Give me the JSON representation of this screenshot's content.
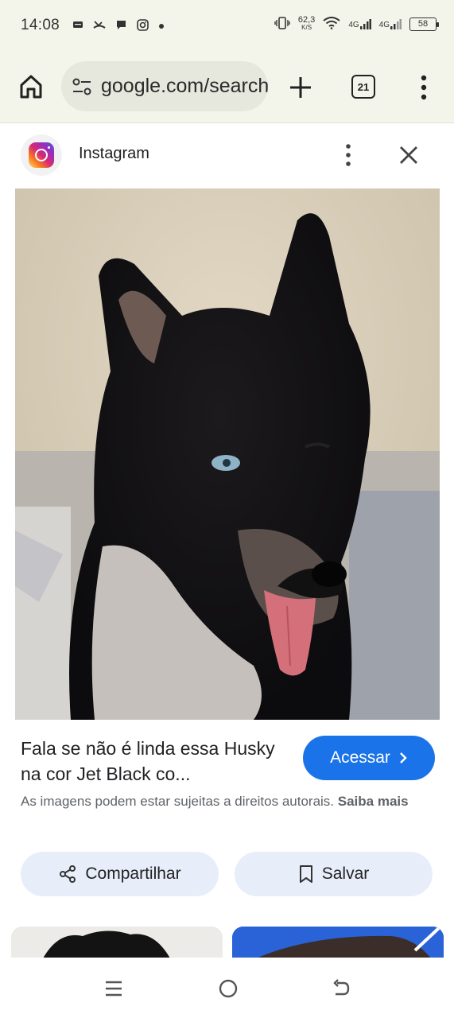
{
  "status_bar": {
    "time": "14:08",
    "speed_value": "62,3",
    "speed_unit": "K/S",
    "network_1": "4G",
    "network_2": "4G",
    "battery": "58"
  },
  "toolbar": {
    "url": "google.com/search",
    "tab_count": "21",
    "icons": [
      "home-icon",
      "tune-icon",
      "plus-icon",
      "tabs-icon",
      "more-vert-icon"
    ]
  },
  "panel": {
    "source_name": "Instagram",
    "title": "Fala se não é linda essa Husky na cor Jet Black co...",
    "access_label": "Acessar",
    "copyright_text": "As imagens podem estar sujeitas a direitos autorais.",
    "copyright_more": "Saiba mais",
    "share_label": "Compartilhar",
    "save_label": "Salvar",
    "accent_color": "#1a73e8"
  },
  "nav_bar": {
    "icons": [
      "recents-icon",
      "home-circle-icon",
      "back-icon"
    ]
  }
}
